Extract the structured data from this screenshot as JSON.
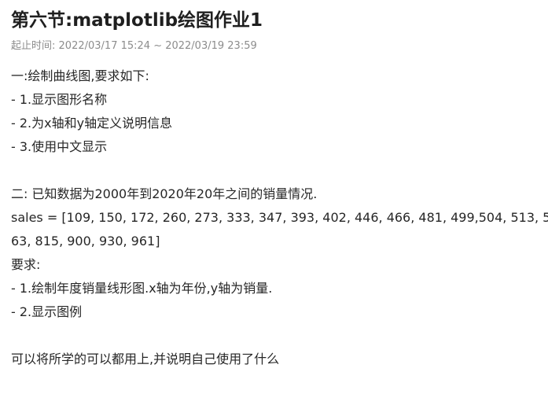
{
  "header": {
    "title": "第六节:matplotlib绘图作业1",
    "time_label": "起止时间:",
    "time_range": "2022/03/17 15:24 ~ 2022/03/19 23:59"
  },
  "assignment": {
    "part1": {
      "heading": "一:绘制曲线图,要求如下:",
      "items": [
        "- 1.显示图形名称",
        "- 2.为x轴和y轴定义说明信息",
        "- 3.使用中文显示"
      ]
    },
    "part2": {
      "heading": "二: 已知数据为2000年到2020年20年之间的销量情况.",
      "sales_line_1": "sales = [109, 150, 172, 260, 273, 333, 347, 393, 402, 446, 466, 481, 499,504, 513, 5",
      "sales_line_2": "63, 815, 900, 930, 961]",
      "requirements_label": "要求:",
      "items": [
        "- 1.绘制年度销量线形图.x轴为年份,y轴为销量.",
        "- 2.显示图例"
      ]
    },
    "closing": "可以将所学的可以都用上,并说明自己使用了什么"
  }
}
